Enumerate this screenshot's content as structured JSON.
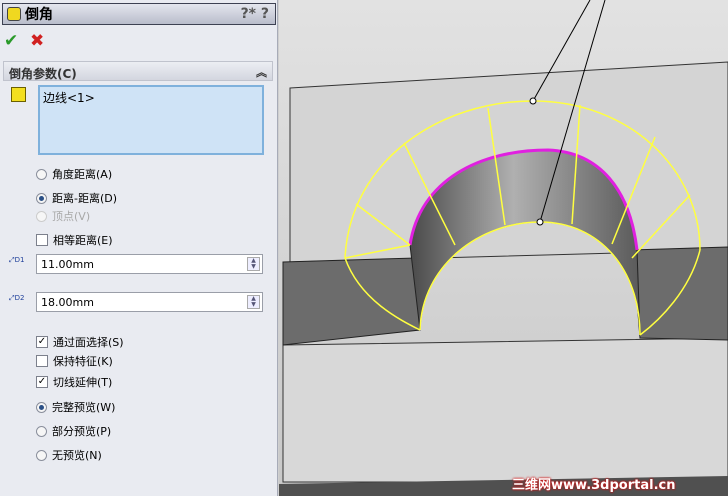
{
  "panel": {
    "title": "倒角",
    "help_icons": "?* ?",
    "ok_icon": "checkmark-icon",
    "cancel_icon": "close-icon",
    "section": "倒角参数(C)",
    "selection": "边线<1>",
    "options": {
      "angle_distance": "角度距离(A)",
      "distance_distance": "距离-距离(D)",
      "vertex": "顶点(V)",
      "equal_distance": "相等距离(E)"
    },
    "d1": {
      "label": "D1",
      "value": "11.00mm"
    },
    "d2": {
      "label": "D2",
      "value": "18.00mm"
    },
    "checks": {
      "select_through_faces": "通过面选择(S)",
      "keep_features": "保持特征(K)",
      "tangent_propagation": "切线延伸(T)"
    },
    "preview": {
      "full": "完整预览(W)",
      "partial": "部分预览(P)",
      "none": "无预览(N)"
    },
    "state": {
      "selected_type": "distance_distance",
      "equal_distance": false,
      "select_through_faces": true,
      "keep_features": false,
      "tangent_propagation": true,
      "preview": "full"
    }
  },
  "watermark": "三维网www.3dportal.cn",
  "colors": {
    "preview_edges": "#ffff40",
    "selected_edge": "#e020e0"
  }
}
